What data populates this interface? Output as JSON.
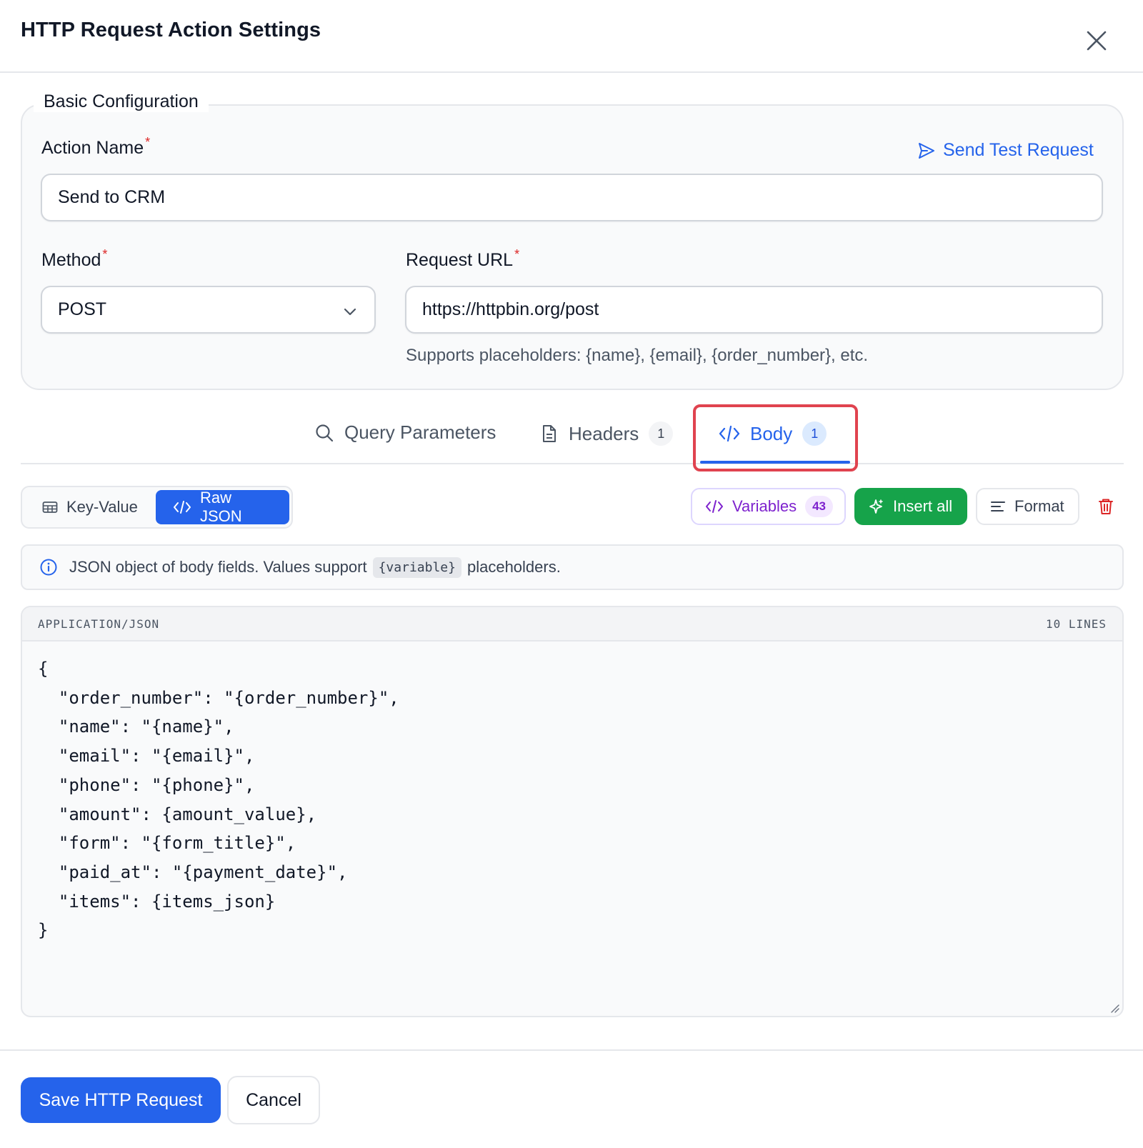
{
  "dialog": {
    "title": "HTTP Request Action Settings"
  },
  "basic_config": {
    "legend": "Basic Configuration",
    "action_name_label": "Action Name",
    "required_mark": "*",
    "action_name_value": "Send to CRM",
    "send_test_label": "Send Test Request",
    "method_label": "Method",
    "method_value": "POST",
    "url_label": "Request URL",
    "url_value": "https://httpbin.org/post",
    "url_hint": "Supports placeholders: {name}, {email}, {order_number}, etc."
  },
  "tabs": [
    {
      "label": "Query Parameters",
      "icon": "search-icon",
      "active": false
    },
    {
      "label": "Headers",
      "icon": "document-icon",
      "count": "1",
      "active": false
    },
    {
      "label": "Body",
      "icon": "code-icon",
      "count": "1",
      "active": true
    }
  ],
  "body_toolbar": {
    "mode_key_value": "Key-Value",
    "mode_raw_json": "Raw JSON",
    "selected_mode": "Raw JSON",
    "variables_label": "Variables",
    "variables_count": "43",
    "insert_all_label": "Insert all",
    "format_label": "Format"
  },
  "info_banner": {
    "text_before": "JSON object of body fields. Values support",
    "code": "{variable}",
    "text_after": "placeholders."
  },
  "editor": {
    "content_type": "APPLICATION/JSON",
    "line_count": "10 LINES",
    "content": "{\n  \"order_number\": \"{order_number}\",\n  \"name\": \"{name}\",\n  \"email\": \"{email}\",\n  \"phone\": \"{phone}\",\n  \"amount\": {amount_value},\n  \"form\": \"{form_title}\",\n  \"paid_at\": \"{payment_date}\",\n  \"items\": {items_json}\n}"
  },
  "footer": {
    "save_label": "Save HTTP Request",
    "cancel_label": "Cancel"
  },
  "colors": {
    "primary": "#2563eb",
    "success": "#16a34a",
    "danger": "#dc2626",
    "variables": "#7e22ce",
    "highlight": "#e0434f"
  }
}
